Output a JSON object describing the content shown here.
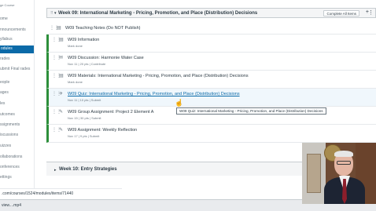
{
  "sidebar": {
    "course_title": "ge Course",
    "items": [
      {
        "label": "ome",
        "active": false
      },
      {
        "label": "nnouncements",
        "active": false
      },
      {
        "label": "yllabus",
        "active": false
      },
      {
        "label": "odules",
        "active": true
      },
      {
        "label": "rades",
        "active": false
      },
      {
        "label": "ubmit Final rades",
        "active": false
      },
      {
        "label": "eople",
        "active": false
      },
      {
        "label": "ages",
        "active": false
      },
      {
        "label": "les",
        "active": false
      },
      {
        "label": "utcomes",
        "active": false
      },
      {
        "label": "ssignments",
        "active": false
      },
      {
        "label": "iscussions",
        "active": false
      },
      {
        "label": "uizzes",
        "active": false
      },
      {
        "label": "ollaborations",
        "active": false
      },
      {
        "label": "onferences",
        "active": false
      },
      {
        "label": "ettings",
        "active": false
      }
    ]
  },
  "module": {
    "title": "Week 09: International Marketing - Pricing, Promotion, and Place (Distribution) Decisions",
    "complete_all_label": "Complete All Items",
    "items": [
      {
        "icon": "document-icon",
        "title": "W09 Teaching Notes (Do NOT Publish)",
        "meta": "",
        "published": false,
        "hovered": false
      },
      {
        "icon": "document-icon",
        "title": "W09 Information",
        "meta": "Mark done",
        "published": true,
        "hovered": false
      },
      {
        "icon": "discussion-icon",
        "title": "W09 Discussion: Harmonie Water Case",
        "meta": "Nov 11 | 20 pts | Contribute",
        "published": true,
        "hovered": false
      },
      {
        "icon": "document-icon",
        "title": "W09 Materials: International Marketing - Pricing, Promotion, and Place (Distribution) Decisions",
        "meta": "Mark done",
        "published": true,
        "hovered": false
      },
      {
        "icon": "quiz-icon",
        "title": "W09 Quiz: International Marketing - Pricing, Promotion, and Place (Distribution) Decisions",
        "meta": "Nov 11 | 10 pts | Submit",
        "published": true,
        "hovered": true
      },
      {
        "icon": "assignment-icon",
        "title": "W09 Group Assignment: Project 2 Element A",
        "meta": "Nov 15 | 30 pts | Submit",
        "published": true,
        "hovered": false
      },
      {
        "icon": "assignment-icon",
        "title": "W09 Assignment: Weekly Reflection",
        "meta": "Nov 17 | 9 pts | Submit",
        "published": true,
        "hovered": false
      }
    ],
    "tooltip": "W09 Quiz: International Marketing - Pricing, Promotion, and Place (Distribution) Decisions"
  },
  "next_module": {
    "title": "Week 10: Entry Strategies"
  },
  "status_bar": {
    "url": ".com/courses/1524/modules/items/71440"
  },
  "download_shelf": {
    "file_label": "view....mp4"
  }
}
